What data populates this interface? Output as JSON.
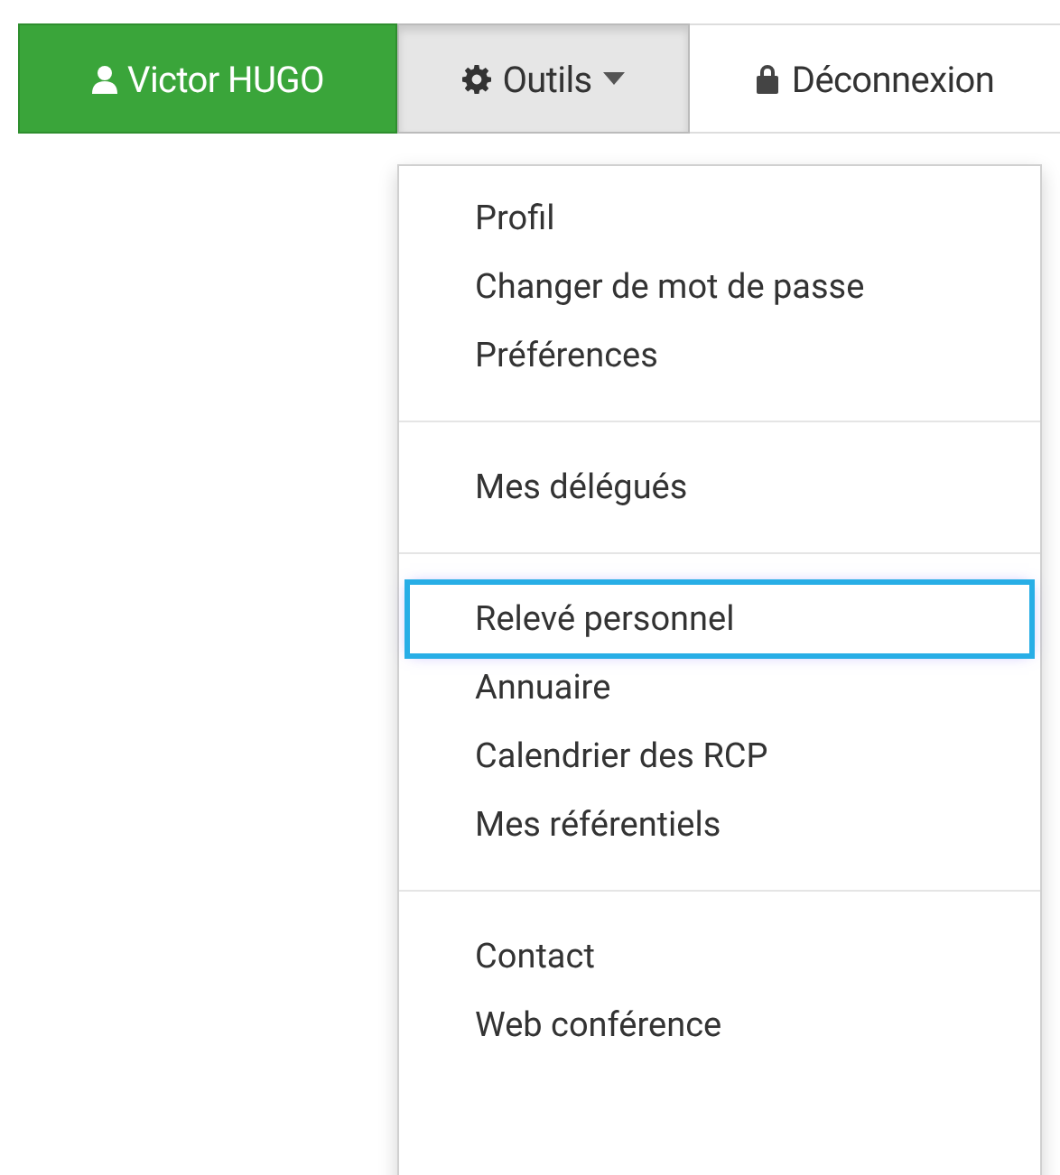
{
  "navbar": [
    {
      "kind": "user",
      "label": "Victor HUGO"
    },
    {
      "kind": "menu",
      "label": "Outils",
      "expanded": true
    },
    {
      "kind": "logout",
      "label": "Déconnexion"
    }
  ],
  "dropdown": {
    "groups": [
      [
        {
          "label": "Profil",
          "focused": false
        },
        {
          "label": "Changer de mot de passe",
          "focused": false
        },
        {
          "label": "Préférences",
          "focused": false
        }
      ],
      [
        {
          "label": "Mes délégués",
          "focused": false
        }
      ],
      [
        {
          "label": "Relevé personnel",
          "focused": true
        },
        {
          "label": "Annuaire",
          "focused": false
        },
        {
          "label": "Calendrier des RCP",
          "focused": false
        },
        {
          "label": "Mes référentiels",
          "focused": false
        }
      ],
      [
        {
          "label": "Contact",
          "focused": false
        },
        {
          "label": "Web conférence",
          "focused": false
        }
      ]
    ]
  }
}
